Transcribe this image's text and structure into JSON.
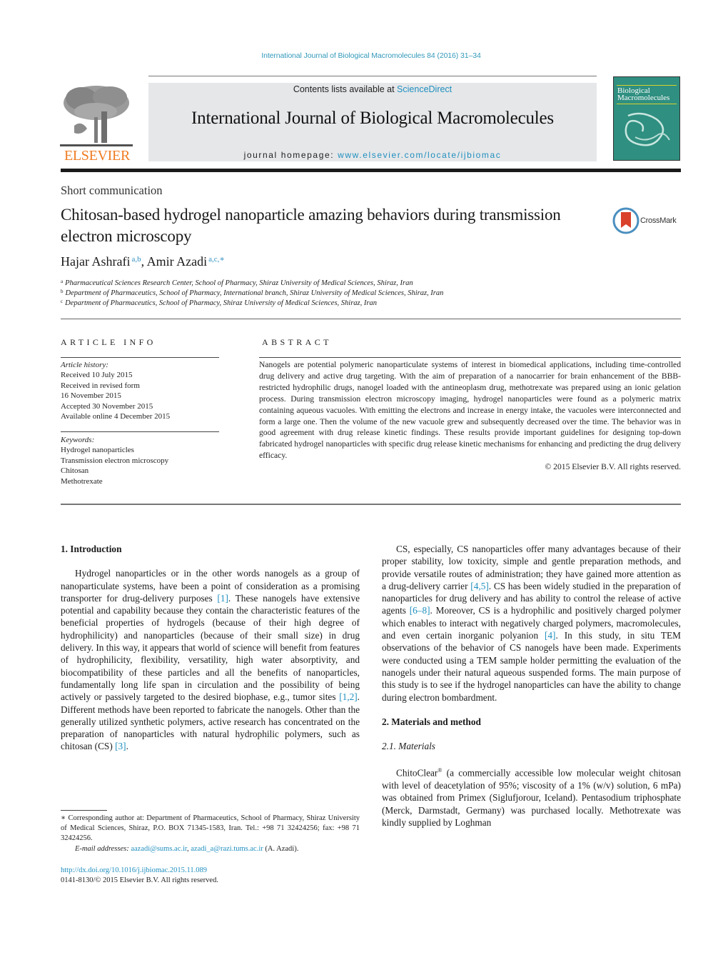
{
  "header": {
    "citation": "International Journal of Biological Macromolecules 84 (2016) 31–34",
    "contents_prefix": "Contents lists available at ",
    "contents_link": "ScienceDirect",
    "journal_name": "International Journal of Biological Macromolecules",
    "homepage_prefix": "journal homepage: ",
    "homepage_link": "www.elsevier.com/locate/ijbiomac",
    "publisher_logo_text": "ELSEVIER",
    "cover_title_line1": "Biological",
    "cover_title_line2": "Macromolecules",
    "crossmark_label": "CrossMark"
  },
  "article": {
    "type": "Short communication",
    "title": "Chitosan-based hydrogel nanoparticle amazing behaviors during transmission electron microscopy",
    "authors": [
      {
        "name": "Hajar Ashrafi",
        "affil": "a,b"
      },
      {
        "name": "Amir Azadi",
        "affil": "a,c,∗"
      }
    ],
    "author_separator": ", ",
    "affiliations": [
      {
        "mark": "a",
        "text": "Pharmaceutical Sciences Research Center, School of Pharmacy, Shiraz University of Medical Sciences, Shiraz, Iran"
      },
      {
        "mark": "b",
        "text": "Department of Pharmaceutics, School of Pharmacy, International branch, Shiraz University of Medical Sciences, Shiraz, Iran"
      },
      {
        "mark": "c",
        "text": "Department of Pharmaceutics, School of Pharmacy, Shiraz University of Medical Sciences, Shiraz, Iran"
      }
    ]
  },
  "article_info": {
    "heading": "ARTICLE INFO",
    "history_label": "Article history:",
    "history": [
      "Received 10 July 2015",
      "Received in revised form",
      "16 November 2015",
      "Accepted 30 November 2015",
      "Available online 4 December 2015"
    ],
    "keywords_label": "Keywords:",
    "keywords": [
      "Hydrogel nanoparticles",
      "Transmission electron microscopy",
      "Chitosan",
      "Methotrexate"
    ]
  },
  "abstract": {
    "heading": "ABSTRACT",
    "text": "Nanogels are potential polymeric nanoparticulate systems of interest in biomedical applications, includ­ing time-controlled drug delivery and active drug targeting. With the aim of preparation of a nanocarrier for brain enhancement of the BBB-restricted hydrophilic drugs, nanogel loaded with the antineo­plasm drug, methotrexate was prepared using an ionic gelation process. During transmission electron microscopy imaging, hydrogel nanoparticles were found as a polymeric matrix containing aqueous vac­uoles. With emitting the electrons and increase in energy intake, the vacuoles were interconnected and form a large one. Then the volume of the new vacuole grew and subsequently decreased over the time. The behavior was in good agreement with drug release kinetic findings. These results provide important guidelines for designing top-down fabricated hydrogel nanoparticles with specific drug release kinetic mechanisms for enhancing and predicting the drug delivery efficacy.",
    "copyright": "© 2015 Elsevier B.V. All rights reserved."
  },
  "body": {
    "sec1_heading": "1.  Introduction",
    "sec1_p1": [
      {
        "t": "Hydrogel nanoparticles or in the other words nanogels as a group of nanoparticulate systems, have been a point of consider­ation as a promising transporter for drug-delivery purposes "
      },
      {
        "ref": "[1]"
      },
      {
        "t": ". These nanogels have extensive potential and capability because they contain the characteristic features of the beneficial properties of hydrogels (because of their high degree of hydrophilicity) and nanoparticles (because of their small size) in drug delivery. In this way, it appears that world of science will benefit from features of hydrophilicity, flexibility, versatility, high water absorptivity, and biocompatibility of these particles and all the benefits of nanoparti­cles, fundamentally long life span in circulation and the possibility of being actively or passively targeted to the desired biophase, e.g., tumor sites "
      },
      {
        "ref": "[1,2]"
      },
      {
        "t": ". Different methods have been reported to fabricate the nanogels. Other than the generally utilized synthetic polymers, active research has concentrated on the preparation of nanopar­ticles with natural hydrophilic polymers, such as chitosan (CS) "
      },
      {
        "ref": "[3]"
      },
      {
        "t": "."
      }
    ],
    "sec1_p2": [
      {
        "t": "CS, especially, CS nanoparticles offer many advantages because of their proper stability, low toxicity, simple and gentle prepa­ration methods, and provide versatile routes of administration; they have gained more attention as a drug-delivery carrier "
      },
      {
        "ref": "[4,5]"
      },
      {
        "t": ". CS has been widely studied in the preparation of nanoparticles for drug delivery and has ability to control the release of active agents "
      },
      {
        "ref": "[6–8]"
      },
      {
        "t": ". Moreover, CS is a hydrophilic and positively charged polymer which enables to interact with negatively charged poly­mers, macromolecules, and even certain inorganic polyanion "
      },
      {
        "ref": "[4]"
      },
      {
        "t": ". In this study, in situ TEM observations of the behavior of CS nanogels have been made. Experiments were conducted using a TEM sample holder permitting the evaluation of the nanogels under their nat­ural aqueous suspended forms. The main purpose of this study is to see if the hydrogel nanoparticles can have the ability to change during electron bombardment."
      }
    ],
    "sec2_heading": "2.  Materials and method",
    "sec2_1_heading": "2.1.  Materials",
    "sec2_1_p1_brand": "ChitoClear",
    "sec2_1_p1_reg": "®",
    "sec2_1_p1_text": " (a commercially accessible low molecular weight chitosan with level of deacetylation of 95%; viscosity of a 1% (w/v) solution, 6 mPa) was obtained from Primex (Siglufjorour, Iceland). Pentasodium triphosphate (Merck, Darmstadt, Germany) was purchased locally. Methotrexate was kindly supplied by Loghman"
  },
  "footnote": {
    "corresponding": "∗  Corresponding author at: Department of Pharmaceutics, School of Phar­macy, Shiraz University of Medical Sciences, Shiraz, P.O. BOX 71345-1583, Iran. Tel.: +98 71 32424256; fax: +98 71 32424256.",
    "email_label": "E-mail addresses:",
    "email1": "aazadi@sums.ac.ir",
    "email_sep": ", ",
    "email2": "azadi_a@razi.tums.ac.ir",
    "email_suffix": " (A. Azadi).",
    "doi": "http://dx.doi.org/10.1016/j.ijbiomac.2015.11.089",
    "issn_copyright": "0141-8130/© 2015 Elsevier B.V. All rights reserved."
  },
  "colors": {
    "link": "#1f8fbf",
    "elsevier_orange": "#f07c22",
    "banner_gray": "#e6e7e9",
    "cover_teal": "#2f8f80"
  }
}
